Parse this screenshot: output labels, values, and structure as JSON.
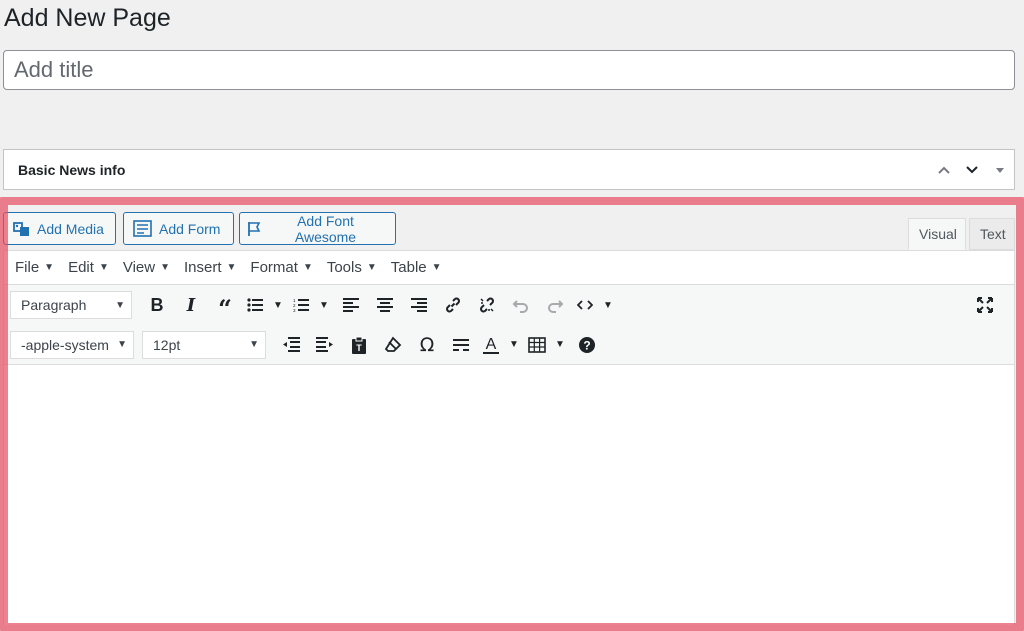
{
  "page": {
    "title": "Add New Page"
  },
  "title_field": {
    "placeholder": "Add title",
    "value": ""
  },
  "metabox": {
    "title": "Basic News info"
  },
  "media_buttons": [
    {
      "label": "Add Media",
      "icon": "media-icon"
    },
    {
      "label": "Add Form",
      "icon": "form-icon"
    },
    {
      "label": "Add Font Awesome",
      "icon": "flag-icon"
    }
  ],
  "editor_tabs": {
    "visual": "Visual",
    "text": "Text",
    "active": "Visual"
  },
  "menubar": [
    "File",
    "Edit",
    "View",
    "Insert",
    "Format",
    "Tools",
    "Table"
  ],
  "toolbar1": {
    "format_select": "Paragraph",
    "buttons": [
      "bold-icon",
      "italic-icon",
      "blockquote-icon",
      "bullet-list-icon",
      "numbered-list-icon",
      "align-left-icon",
      "align-center-icon",
      "align-right-icon",
      "link-icon",
      "unlink-icon",
      "undo-icon",
      "redo-icon",
      "code-icon",
      "fullscreen-icon"
    ]
  },
  "toolbar2": {
    "font_family": "-apple-system",
    "font_size": "12pt",
    "buttons": [
      "outdent-icon",
      "indent-icon",
      "paste-text-icon",
      "clear-formatting-icon",
      "special-character-icon",
      "horizontal-line-icon",
      "text-color-icon",
      "table-icon",
      "help-icon"
    ]
  },
  "colors": {
    "accent": "#2271b1",
    "highlight": "#e74c60"
  }
}
